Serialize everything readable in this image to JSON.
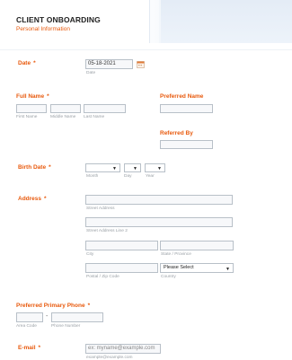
{
  "header": {
    "title": "CLIENT ONBOARDING",
    "subtitle": "Personal Information"
  },
  "date": {
    "label": "Date",
    "required_mark": "*",
    "value": "05-18-2021",
    "sublabel": "Date"
  },
  "full_name": {
    "label": "Full Name",
    "required_mark": "*",
    "first_sublabel": "First Name",
    "middle_sublabel": "Middle Name",
    "last_sublabel": "Last Name"
  },
  "preferred_name": {
    "label": "Preferred Name"
  },
  "referred_by": {
    "label": "Referred By"
  },
  "birth_date": {
    "label": "Birth Date",
    "required_mark": "*",
    "month_sublabel": "Month",
    "day_sublabel": "Day",
    "year_sublabel": "Year"
  },
  "address": {
    "label": "Address",
    "required_mark": "*",
    "street_sublabel": "Street Address",
    "street2_sublabel": "Street Address Line 2",
    "city_sublabel": "City",
    "state_sublabel": "State / Province",
    "postal_sublabel": "Postal / Zip Code",
    "country_sublabel": "Country",
    "country_value": "Please Select"
  },
  "phone": {
    "label": "Preferred Primary Phone",
    "required_mark": "*",
    "separator": "-",
    "area_sublabel": "Area Code",
    "number_sublabel": "Phone Number"
  },
  "email": {
    "label": "E-mail",
    "required_mark": "*",
    "placeholder": "ex: myname@example.com",
    "sublabel": "example@example.com"
  },
  "colors": {
    "accent": "#e8590c",
    "header_blue": "#e4ecf6"
  }
}
